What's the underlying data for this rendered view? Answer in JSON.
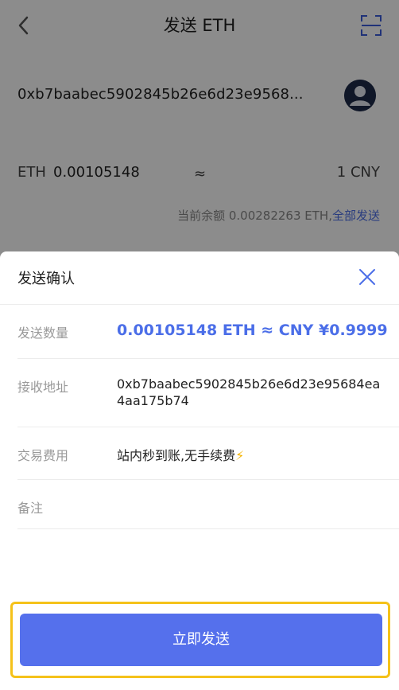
{
  "header": {
    "title": "发送 ETH"
  },
  "form": {
    "address": "0xb7baabec5902845b26e6d23e9568...",
    "currency": "ETH",
    "amount": "0.00105148",
    "approx_symbol": "≈",
    "fiat_value": "1 CNY",
    "balance_text": "当前余额 0.00282263 ETH,",
    "send_all_label": "全部发送"
  },
  "confirm": {
    "title": "发送确认",
    "rows": [
      {
        "label": "发送数量",
        "value": "0.00105148 ETH ≈ CNY ¥0.9999"
      },
      {
        "label": "接收地址",
        "value": "0xb7baabec5902845b26e6d23e95684ea4aa175b74"
      },
      {
        "label": "交易费用",
        "value": "站内秒到账,无手续费"
      },
      {
        "label": "备注",
        "value": ""
      }
    ],
    "bolt": "⚡",
    "send_button": "立即发送"
  },
  "colors": {
    "accent": "#5570ec",
    "link": "#4b6ee8",
    "highlight": "#f5c21a"
  }
}
